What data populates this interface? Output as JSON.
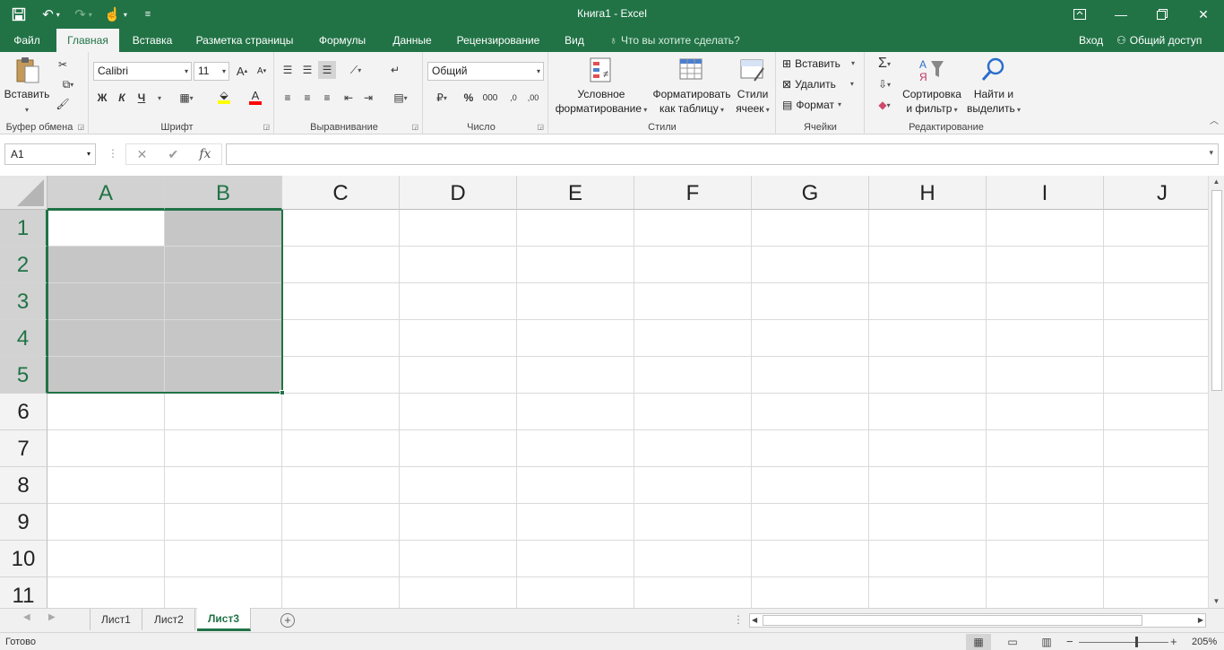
{
  "window": {
    "title": "Книга1 - Excel"
  },
  "qat": {
    "save": "save-icon",
    "undo": "undo-icon",
    "redo": "redo-icon",
    "touch": "touch-mode-icon",
    "customize": "customize-qat-icon"
  },
  "window_controls": {
    "ribbon_display": "ribbon-display-icon",
    "minimize": "minimize-icon",
    "restore": "restore-icon",
    "close": "close-icon"
  },
  "tabs": [
    {
      "label": "Файл"
    },
    {
      "label": "Главная"
    },
    {
      "label": "Вставка"
    },
    {
      "label": "Разметка страницы"
    },
    {
      "label": "Формулы"
    },
    {
      "label": "Данные"
    },
    {
      "label": "Рецензирование"
    },
    {
      "label": "Вид"
    }
  ],
  "tell_me": "Что вы хотите сделать?",
  "account": {
    "login": "Вход",
    "share": "Общий доступ"
  },
  "ribbon": {
    "clipboard": {
      "label": "Буфер обмена",
      "paste": "Вставить"
    },
    "font": {
      "label": "Шрифт",
      "name": "Calibri",
      "size": "11",
      "bold": "Ж",
      "italic": "К",
      "underline": "Ч",
      "grow": "A",
      "shrink": "A",
      "color_letter": "A",
      "fill_color": "#ffff00",
      "font_color": "#ff0000"
    },
    "alignment": {
      "label": "Выравнивание"
    },
    "number": {
      "label": "Число",
      "format": "Общий",
      "percent": "%",
      "thousands": "000",
      "inc_decimal": ",0",
      "dec_decimal": ",00"
    },
    "styles": {
      "label": "Стили",
      "conditional_1": "Условное",
      "conditional_2": "форматирование",
      "table_1": "Форматировать",
      "table_2": "как таблицу",
      "cell_1": "Стили",
      "cell_2": "ячеек"
    },
    "cells": {
      "label": "Ячейки",
      "insert": "Вставить",
      "delete": "Удалить",
      "format": "Формат"
    },
    "editing": {
      "label": "Редактирование",
      "sort_1": "Сортировка",
      "sort_2": "и фильтр",
      "find_1": "Найти и",
      "find_2": "выделить"
    }
  },
  "formula_bar": {
    "namebox": "A1",
    "fx": "fx",
    "cancel": "✕",
    "enter": "✔",
    "content": ""
  },
  "grid": {
    "columns": [
      "A",
      "B",
      "C",
      "D",
      "E",
      "F",
      "G",
      "H",
      "I",
      "J"
    ],
    "rows": [
      "1",
      "2",
      "3",
      "4",
      "5",
      "6",
      "7",
      "8",
      "9",
      "10",
      "11"
    ],
    "selection": "A1:B5",
    "active_cell": "A1",
    "accent": "#217346"
  },
  "sheets": [
    {
      "label": "Лист1"
    },
    {
      "label": "Лист2"
    },
    {
      "label": "Лист3"
    }
  ],
  "active_sheet": "Лист3",
  "status": {
    "text": "Готово",
    "zoom": "205%"
  }
}
